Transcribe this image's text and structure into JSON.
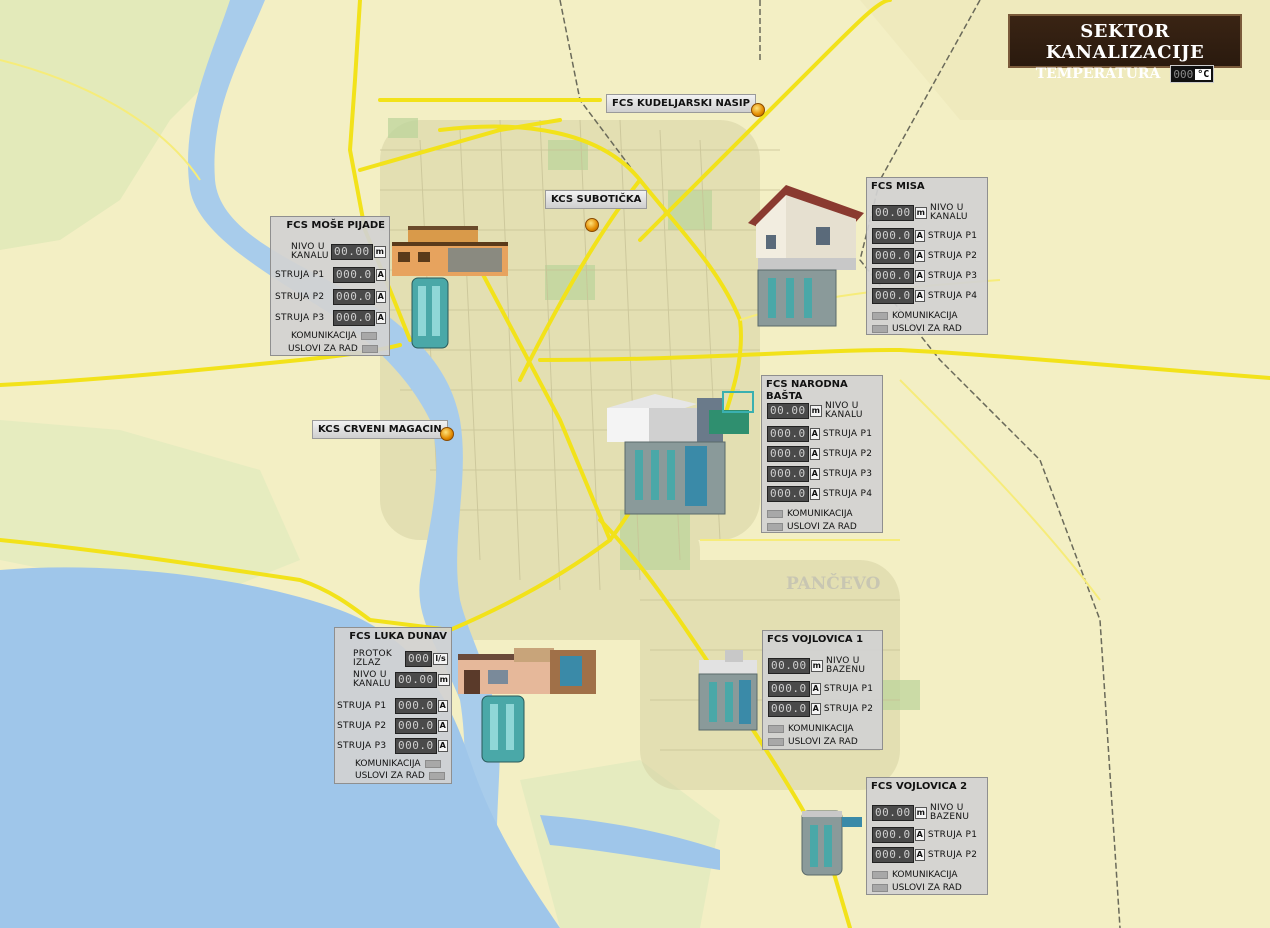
{
  "header": {
    "title": "SEKTOR KANALIZACIJE",
    "temp_label": "TEMPERATURA",
    "temp_value": "000",
    "temp_unit": "°C"
  },
  "map": {
    "city_label": "PANČEVO"
  },
  "sites": {
    "kudeljarski": "FCS KUDELJARSKI NASIP",
    "suboticka": "KCS SUBOTIČKA",
    "crveni_magacin": "KCS CRVENI MAGACIN"
  },
  "panels": {
    "mose_pijade": {
      "title": "FCS MOŠE PIJADE",
      "nivo": {
        "label": "NIVO U KANALU",
        "value": "00.00",
        "unit": "m"
      },
      "p1": {
        "label": "STRUJA P1",
        "value": "000.0",
        "unit": "A"
      },
      "p2": {
        "label": "STRUJA P2",
        "value": "000.0",
        "unit": "A"
      },
      "p3": {
        "label": "STRUJA P3",
        "value": "000.0",
        "unit": "A"
      },
      "kom": "KOMUNIKACIJA",
      "uslovi": "USLOVI ZA RAD"
    },
    "misa": {
      "title": "FCS MISA",
      "nivo": {
        "label": "NIVO U KANALU",
        "value": "00.00",
        "unit": "m"
      },
      "p1": {
        "label": "STRUJA P1",
        "value": "000.0",
        "unit": "A"
      },
      "p2": {
        "label": "STRUJA P2",
        "value": "000.0",
        "unit": "A"
      },
      "p3": {
        "label": "STRUJA P3",
        "value": "000.0",
        "unit": "A"
      },
      "p4": {
        "label": "STRUJA P4",
        "value": "000.0",
        "unit": "A"
      },
      "kom": "KOMUNIKACIJA",
      "uslovi": "USLOVI ZA RAD"
    },
    "narodna_basta": {
      "title": "FCS NARODNA BAŠTA",
      "nivo": {
        "label": "NIVO U KANALU",
        "value": "00.00",
        "unit": "m"
      },
      "p1": {
        "label": "STRUJA P1",
        "value": "000.0",
        "unit": "A"
      },
      "p2": {
        "label": "STRUJA P2",
        "value": "000.0",
        "unit": "A"
      },
      "p3": {
        "label": "STRUJA P3",
        "value": "000.0",
        "unit": "A"
      },
      "p4": {
        "label": "STRUJA P4",
        "value": "000.0",
        "unit": "A"
      },
      "kom": "KOMUNIKACIJA",
      "uslovi": "USLOVI ZA RAD"
    },
    "luka_dunav": {
      "title": "FCS LUKA DUNAV",
      "protok": {
        "label": "PROTOK IZLAZ",
        "value": "000",
        "unit": "l/s"
      },
      "nivo": {
        "label": "NIVO U KANALU",
        "value": "00.00",
        "unit": "m"
      },
      "p1": {
        "label": "STRUJA P1",
        "value": "000.0",
        "unit": "A"
      },
      "p2": {
        "label": "STRUJA P2",
        "value": "000.0",
        "unit": "A"
      },
      "p3": {
        "label": "STRUJA P3",
        "value": "000.0",
        "unit": "A"
      },
      "kom": "KOMUNIKACIJA",
      "uslovi": "USLOVI ZA RAD"
    },
    "vojlovica1": {
      "title": "FCS VOJLOVICA 1",
      "nivo": {
        "label": "NIVO U BAZENU",
        "value": "00.00",
        "unit": "m"
      },
      "p1": {
        "label": "STRUJA P1",
        "value": "000.0",
        "unit": "A"
      },
      "p2": {
        "label": "STRUJA P2",
        "value": "000.0",
        "unit": "A"
      },
      "kom": "KOMUNIKACIJA",
      "uslovi": "USLOVI ZA RAD"
    },
    "vojlovica2": {
      "title": "FCS VOJLOVICA 2",
      "nivo": {
        "label": "NIVO U BAZENU",
        "value": "00.00",
        "unit": "m"
      },
      "p1": {
        "label": "STRUJA P1",
        "value": "000.0",
        "unit": "A"
      },
      "p2": {
        "label": "STRUJA P2",
        "value": "000.0",
        "unit": "A"
      },
      "kom": "KOMUNIKACIJA",
      "uslovi": "USLOVI ZA RAD"
    }
  },
  "colors": {
    "map_bg": "#f3efc4",
    "road": "#f2e21a",
    "river": "#9fc6ea",
    "header_bg": "#2a1a0e",
    "panel_bg": "#d2d2d2",
    "station_dot": "#e38b00"
  }
}
